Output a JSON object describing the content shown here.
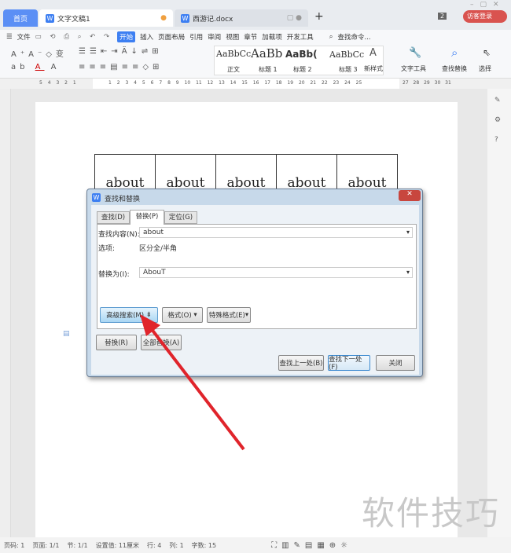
{
  "tabs": {
    "home": "首页",
    "doc1": "文字文稿1",
    "doc2": "西游记.docx",
    "badge": "2",
    "login": "访客登录"
  },
  "menu": {
    "file": "文件",
    "items": [
      "开始",
      "插入",
      "页面布局",
      "引用",
      "审阅",
      "视图",
      "章节",
      "加载项",
      "开发工具"
    ],
    "search": "查找命令..."
  },
  "ribbon": {
    "styles": [
      {
        "preview": "AaBbCc",
        "name": "正文"
      },
      {
        "preview": "AaBb",
        "name": "标题 1"
      },
      {
        "preview": "AaBb(",
        "name": "标题 2"
      },
      {
        "preview": "AaBbCc",
        "name": "标题 3"
      }
    ],
    "new_style": "新样式",
    "text_tools": "文字工具",
    "find_replace": "查找替换",
    "select": "选择"
  },
  "ruler": {
    "left": "5 4 3 2 1",
    "main": "1 2 3 4 5 6 7 8 9 10 11 12 13 14 15 16 17 18 19 20 21 22 23 24 25",
    "right": "27 28 29 30 31"
  },
  "table": {
    "cells": [
      "about",
      "about",
      "about",
      "about",
      "about"
    ]
  },
  "dialog": {
    "title": "查找和替换",
    "tabs": [
      "查找(D)",
      "替换(P)",
      "定位(G)"
    ],
    "find_label": "查找内容(N):",
    "find_value": "about",
    "options_label": "选项:",
    "options_value": "区分全/半角",
    "replace_label": "替换为(I):",
    "replace_value": "AbouT",
    "advanced": "高级搜索(M)",
    "format": "格式(O)",
    "special": "特殊格式(E)",
    "replace": "替换(R)",
    "replace_all": "全部替换(A)",
    "find_prev": "查找上一处(B)",
    "find_next": "查找下一处(F)",
    "close": "关闭"
  },
  "status": [
    "页码: 1",
    "页面: 1/1",
    "节: 1/1",
    "设置值: 11厘米",
    "行: 4",
    "列: 1",
    "字数: 15"
  ],
  "watermark": "软件技巧",
  "colors": {
    "accent": "#3d7ff2",
    "arrow": "#e0242b",
    "login": "#d9534f"
  }
}
